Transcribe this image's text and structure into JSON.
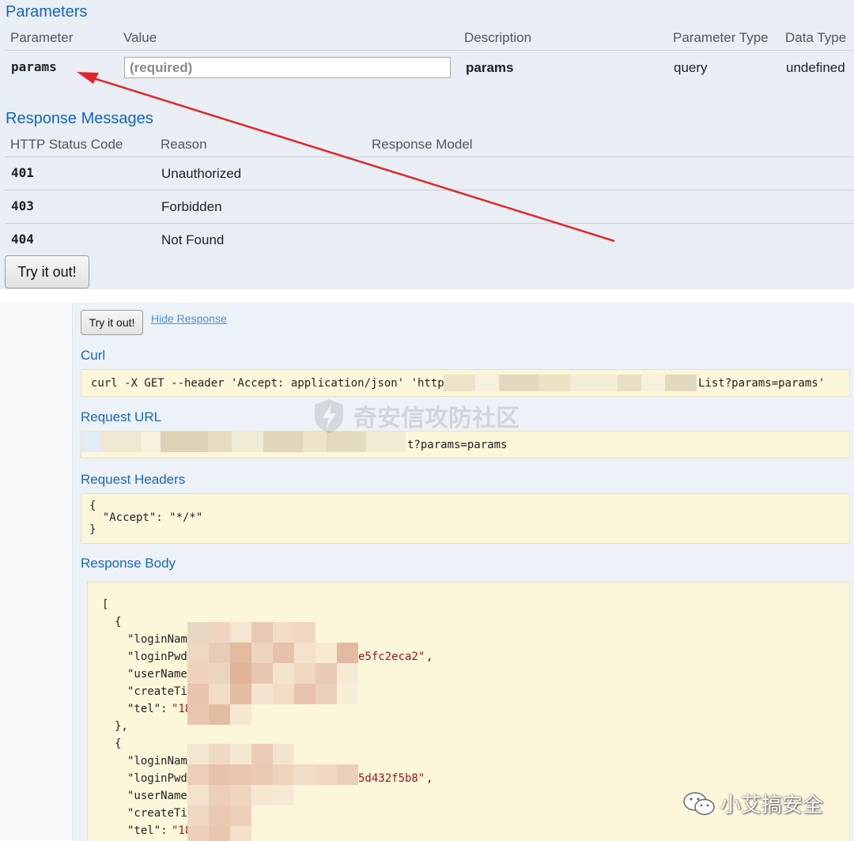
{
  "parameters": {
    "title": "Parameters",
    "headers": [
      "Parameter",
      "Value",
      "Description",
      "Parameter Type",
      "Data Type"
    ],
    "row": {
      "name": "params",
      "placeholder": "(required)",
      "description": "params",
      "param_type": "query",
      "data_type": "undefined"
    }
  },
  "responses": {
    "title": "Response Messages",
    "headers": [
      "HTTP Status Code",
      "Reason",
      "Response Model"
    ],
    "rows": [
      {
        "code": "401",
        "reason": "Unauthorized"
      },
      {
        "code": "403",
        "reason": "Forbidden"
      },
      {
        "code": "404",
        "reason": "Not Found"
      }
    ],
    "try_label": "Try it out!"
  },
  "result": {
    "try_label": "Try it out!",
    "hide_label": "Hide Response",
    "curl_title": "Curl",
    "curl_prefix": "curl -X GET --header 'Accept: application/json' 'http:/",
    "curl_suffix": "List?params=params'",
    "request_url_title": "Request URL",
    "request_url_suffix": "t?params=params",
    "request_headers_title": "Request Headers",
    "request_headers_body": "{\n  \"Accept\": \"*/*\"\n}",
    "response_body_title": "Response Body",
    "body": {
      "open_bracket": "[",
      "open_brace": "{",
      "close_brace": "},",
      "items": [
        {
          "login_name": "\"loginName",
          "login_pwd": "\"loginPwd\"",
          "pwd_tail": "e5fc2eca2\"",
          "user_name": "\"userName\"",
          "create_time": "\"createTim",
          "tel": "\"tel\": ",
          "tel_value": "\"18"
        },
        {
          "login_name": "\"loginName",
          "login_pwd": "\"loginPwd\"",
          "pwd_tail": "5d432f5b8\"",
          "user_name": "\"userName\"",
          "create_time": "\"createTim",
          "tel": "\"tel\": ",
          "tel_value": "\"18"
        }
      ]
    },
    "watermark": "奇安信攻防社区",
    "wechat_label": "小艾搞安全"
  }
}
